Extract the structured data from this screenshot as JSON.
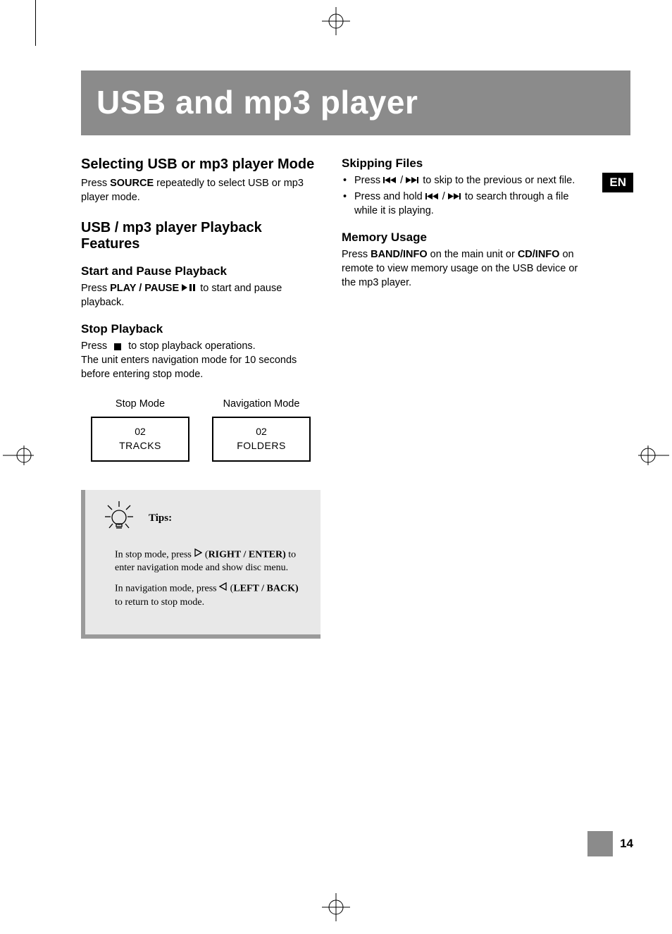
{
  "lang_badge": "EN",
  "page_number": "14",
  "title": "USB and mp3 player",
  "left": {
    "section1": {
      "heading": "Selecting USB or mp3 player Mode",
      "p1_pre": "Press ",
      "p1_bold": "SOURCE",
      "p1_post": " repeatedly to select USB or mp3 player mode."
    },
    "section2": {
      "heading": "USB / mp3 player Playback Features",
      "sub1": {
        "heading": "Start and Pause Playback",
        "p_pre": "Press ",
        "p_bold": "PLAY / PAUSE",
        "p_icon": " ▶ II ",
        "p_post": " to start and pause playback."
      },
      "sub2": {
        "heading": "Stop Playback",
        "p1_a": "Press ",
        "p1_b": " to stop playback operations.",
        "p2": "The unit enters navigation mode for 10 seconds before entering stop mode."
      }
    },
    "modes": {
      "stop": {
        "label": "Stop Mode",
        "num": "02",
        "txt": "TRACKS"
      },
      "nav": {
        "label": "Navigation Mode",
        "num": "02",
        "txt": "FOLDERS"
      }
    },
    "tips": {
      "title": "Tips:",
      "line1_a": "In stop mode, press ",
      "line1_icon": "▷",
      "line1_b": " (",
      "line1_bold": "RIGHT / ENTER)",
      "line1_c": " to enter navigation mode and show disc menu.",
      "line2_a": "In navigation mode, press ",
      "line2_icon": "◁",
      "line2_b": " (",
      "line2_bold": "LEFT / BACK)",
      "line2_c": " to return to stop mode."
    }
  },
  "right": {
    "skip": {
      "heading": "Skipping Files",
      "b1_a": " Press  ",
      "b1_b": "  /  ",
      "b1_c": "  to skip to the previous or next file.",
      "b2_a": "Press and hold  ",
      "b2_b": "  /  ",
      "b2_c": "  to search through  a file while it is playing."
    },
    "mem": {
      "heading": "Memory Usage",
      "p_a": "Press ",
      "p_bold1": "BAND/INFO",
      "p_b": " on the main unit or ",
      "p_bold2": "CD/INFO",
      "p_c": " on remote to view memory usage on the USB device or the mp3 player."
    }
  }
}
